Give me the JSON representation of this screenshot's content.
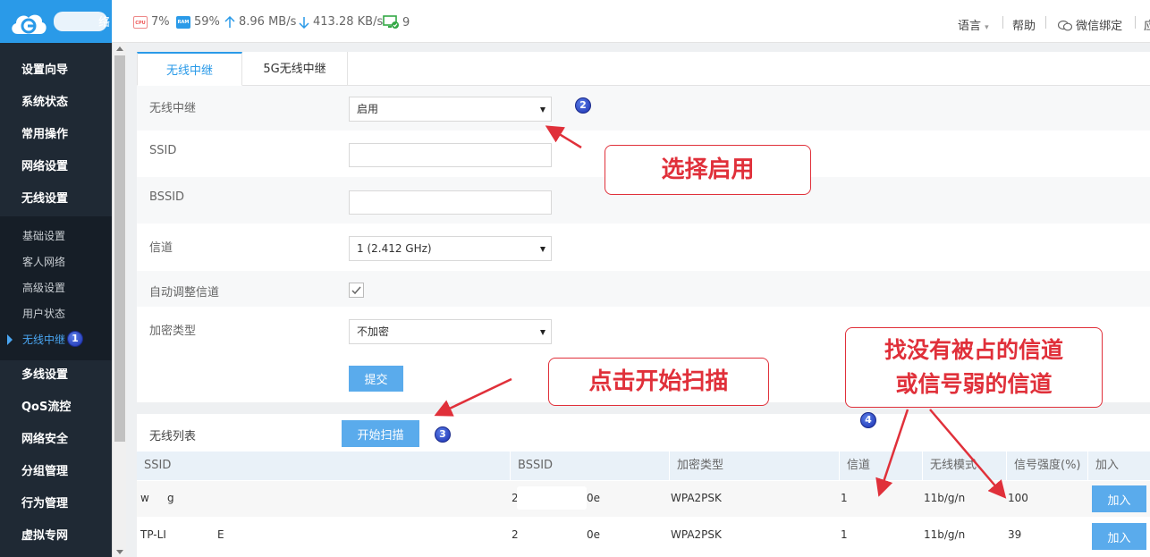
{
  "topbar": {
    "brand_tail": "络",
    "cpu": {
      "icon": "cpu-chip-icon",
      "value": "7%"
    },
    "ram": {
      "icon": "ram-chip-icon",
      "value": "59%"
    },
    "upload": {
      "icon": "upload-arrow-icon",
      "value": "8.96 MB/s"
    },
    "download": {
      "icon": "download-arrow-icon",
      "value": "413.28 KB/s"
    },
    "devices": {
      "icon": "monitor-check-icon",
      "value": "9"
    },
    "language": "语言",
    "help": "帮助",
    "wechat": "微信绑定",
    "cut_off": "应"
  },
  "sidebar": {
    "items": [
      {
        "label": "设置向导"
      },
      {
        "label": "系统状态"
      },
      {
        "label": "常用操作"
      },
      {
        "label": "网络设置"
      },
      {
        "label": "无线设置"
      }
    ],
    "submenu": [
      {
        "label": "基础设置"
      },
      {
        "label": "客人网络"
      },
      {
        "label": "高级设置"
      },
      {
        "label": "用户状态"
      },
      {
        "label": "无线中继",
        "active": true
      }
    ],
    "items_after": [
      {
        "label": "多线设置"
      },
      {
        "label": "QoS流控"
      },
      {
        "label": "网络安全"
      },
      {
        "label": "分组管理"
      },
      {
        "label": "行为管理"
      },
      {
        "label": "虚拟专网"
      }
    ]
  },
  "tabs": [
    {
      "label": "无线中继",
      "active": true
    },
    {
      "label": "5G无线中继",
      "active": false
    }
  ],
  "form": {
    "relay_label": "无线中继",
    "relay_value": "启用",
    "ssid_label": "SSID",
    "ssid_value": "",
    "bssid_label": "BSSID",
    "bssid_value": "",
    "channel_label": "信道",
    "channel_value": "1 (2.412 GHz)",
    "auto_channel_label": "自动调整信道",
    "auto_channel_checked": true,
    "encryption_label": "加密类型",
    "encryption_value": "不加密",
    "submit_label": "提交"
  },
  "list": {
    "title": "无线列表",
    "scan_label": "开始扫描",
    "columns": [
      "SSID",
      "BSSID",
      "加密类型",
      "信道",
      "无线模式",
      "信号强度(%)",
      "加入"
    ],
    "rows": [
      {
        "ssid_a": "w",
        "ssid_b": "g",
        "bssid_a": "2",
        "bssid_b": "0e",
        "encryption": "WPA2PSK",
        "channel": "1",
        "mode": "11b/g/n",
        "signal": "100",
        "join": "加入"
      },
      {
        "ssid_a": "TP-LI",
        "ssid_b": "E",
        "bssid_a": "2",
        "bssid_b": "0e",
        "encryption": "WPA2PSK",
        "channel": "1",
        "mode": "11b/g/n",
        "signal": "39",
        "join": "加入"
      }
    ]
  },
  "annotations": {
    "badge1": "1",
    "badge2": "2",
    "badge3": "3",
    "badge4": "4",
    "callout_enable": "选择启用",
    "callout_scan": "点击开始扫描",
    "callout_channel_line1": "找没有被占的信道",
    "callout_channel_line2": "或信号弱的信道"
  },
  "colors": {
    "accent": "#2a9ae8",
    "sidebar_bg": "#1f2934",
    "annotation_red": "#e0303a",
    "button": "#5aabec"
  }
}
